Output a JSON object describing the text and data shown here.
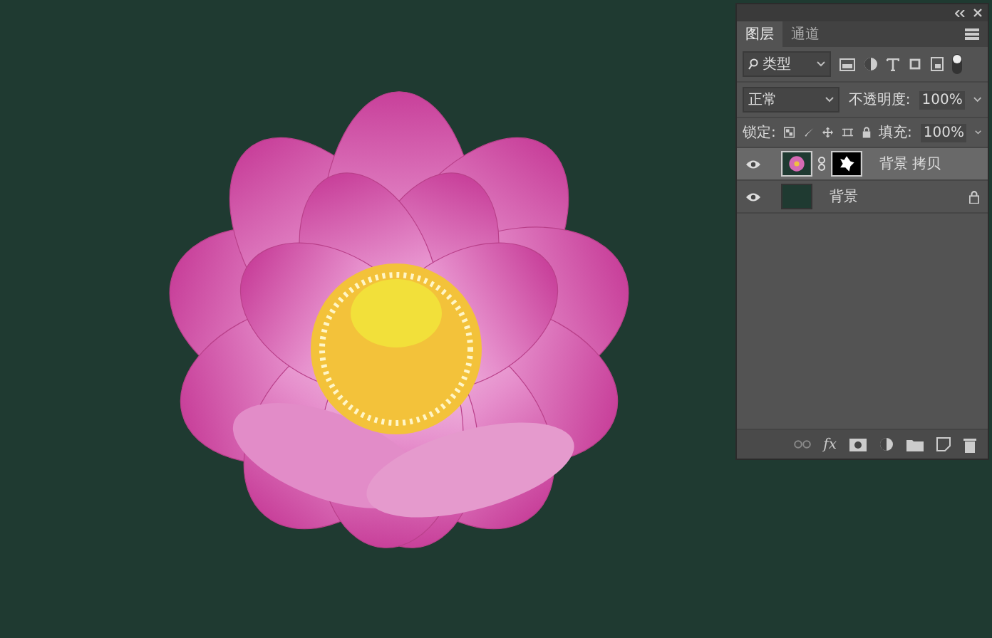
{
  "tabs": [
    {
      "label": "图层",
      "selected": true
    },
    {
      "label": "通道",
      "selected": false
    }
  ],
  "filter": {
    "value": "类型"
  },
  "blend_mode": {
    "value": "正常"
  },
  "opacity": {
    "label": "不透明度:",
    "value": "100%"
  },
  "lock": {
    "label": "锁定:"
  },
  "fill": {
    "label": "填充:",
    "value": "100%"
  },
  "layers": [
    {
      "name": "背景 拷贝",
      "selected": true,
      "visible": true,
      "has_mask": true,
      "locked": false,
      "kind": "photo"
    },
    {
      "name": "背景",
      "selected": false,
      "visible": true,
      "has_mask": false,
      "locked": true,
      "kind": "fill"
    }
  ],
  "footer": {
    "fx": "fx"
  }
}
